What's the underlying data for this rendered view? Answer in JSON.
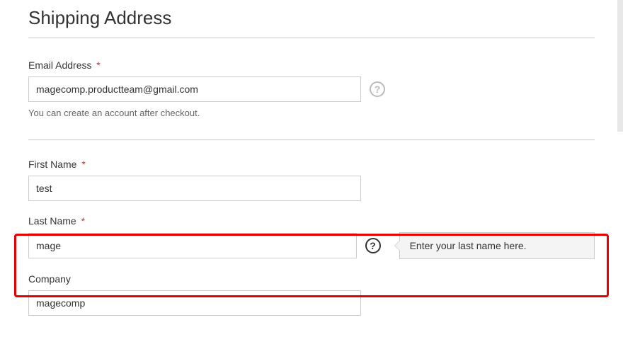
{
  "title": "Shipping Address",
  "fields": {
    "email": {
      "label": "Email Address",
      "required": true,
      "value": "magecomp.productteam@gmail.com",
      "hint": "You can create an account after checkout."
    },
    "first_name": {
      "label": "First Name",
      "required": true,
      "value": "test"
    },
    "last_name": {
      "label": "Last Name",
      "required": true,
      "value": "mage",
      "tooltip": "Enter your last name here."
    },
    "company": {
      "label": "Company",
      "required": false,
      "value": "magecomp"
    }
  },
  "required_asterisk": "*"
}
